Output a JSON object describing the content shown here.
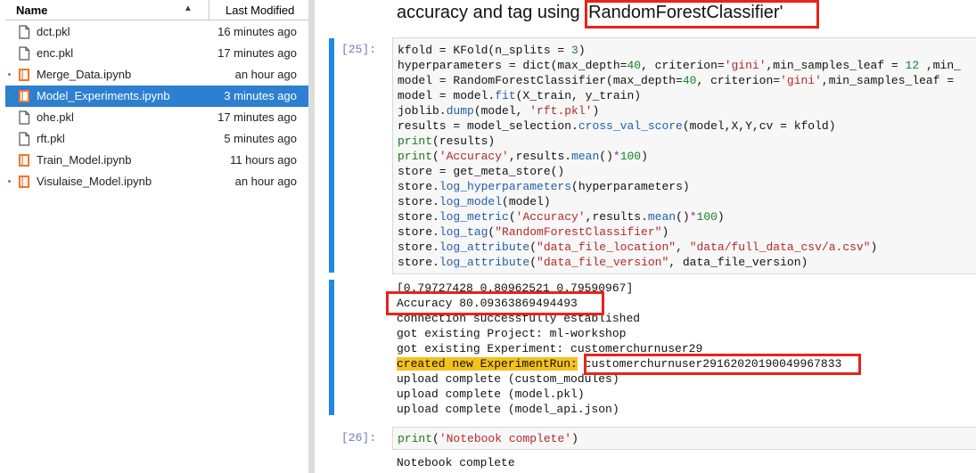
{
  "file_browser": {
    "header": {
      "name_label": "Name",
      "sort_indicator": "▲",
      "modified_label": "Last Modified"
    },
    "files": [
      {
        "name": "dct.pkl",
        "modified": "16 minutes ago",
        "type": "file",
        "running": false,
        "selected": false
      },
      {
        "name": "enc.pkl",
        "modified": "17 minutes ago",
        "type": "file",
        "running": false,
        "selected": false
      },
      {
        "name": "Merge_Data.ipynb",
        "modified": "an hour ago",
        "type": "notebook",
        "running": true,
        "selected": false
      },
      {
        "name": "Model_Experiments.ipynb",
        "modified": "3 minutes ago",
        "type": "notebook",
        "running": true,
        "selected": true
      },
      {
        "name": "ohe.pkl",
        "modified": "17 minutes ago",
        "type": "file",
        "running": false,
        "selected": false
      },
      {
        "name": "rft.pkl",
        "modified": "5 minutes ago",
        "type": "file",
        "running": false,
        "selected": false
      },
      {
        "name": "Train_Model.ipynb",
        "modified": "11 hours ago",
        "type": "notebook",
        "running": false,
        "selected": false
      },
      {
        "name": "Visulaise_Model.ipynb",
        "modified": "an hour ago",
        "type": "notebook",
        "running": true,
        "selected": false
      }
    ]
  },
  "notebook": {
    "markdown": {
      "text_before": "accuracy and tag using ",
      "highlight": "'RandomForestClassifier'"
    },
    "cell25": {
      "prompt": "[25]:",
      "code": {
        "l1": {
          "a": "kfold = KFold(n_splits = ",
          "b": "3",
          "c": ")"
        },
        "l2": {
          "a": "hyperparameters = dict(max_depth=",
          "b": "40",
          "c": ", criterion=",
          "d": "'gini'",
          "e": ",min_samples_leaf = ",
          "f": "12",
          "g": " ,min_"
        },
        "l3": {
          "a": "model = RandomForestClassifier(max_depth=",
          "b": "40",
          "c": ", criterion=",
          "d": "'gini'",
          "e": ",min_samples_leaf = "
        },
        "l4": {
          "a": "model = model.",
          "b": "fit",
          "c": "(X_train, y_train)"
        },
        "l5": {
          "a": "joblib.",
          "b": "dump",
          "c": "(model, ",
          "d": "'rft.pkl'",
          "e": ")"
        },
        "l6": {
          "a": "results = model_selection.",
          "b": "cross_val_score",
          "c": "(model,X,Y,cv = kfold)"
        },
        "l7": {
          "a": "print",
          "b": "(results)"
        },
        "l8": {
          "a": "print",
          "b": "(",
          "c": "'Accuracy'",
          "d": ",results.",
          "e": "mean",
          "f": "()",
          "g": "*",
          "h": "100",
          "i": ")"
        },
        "l9": {
          "a": "store = get_meta_store()"
        },
        "l10": {
          "a": "store.",
          "b": "log_hyperparameters",
          "c": "(hyperparameters)"
        },
        "l11": {
          "a": "store.",
          "b": "log_model",
          "c": "(model)"
        },
        "l12": {
          "a": "store.",
          "b": "log_metric",
          "c": "(",
          "d": "'Accuracy'",
          "e": ",results.",
          "f": "mean",
          "g": "()",
          "h": "*",
          "i": "100",
          "j": ")"
        },
        "l13": {
          "a": "store.",
          "b": "log_tag",
          "c": "(",
          "d": "\"RandomForestClassifier\"",
          "e": ")"
        },
        "l14": {
          "a": "store.",
          "b": "log_attribute",
          "c": "(",
          "d": "\"data_file_location\"",
          "e": ", ",
          "f": "\"data/full_data_csv/a.csv\"",
          "g": ")"
        },
        "l15": {
          "a": "store.",
          "b": "log_attribute",
          "c": "(",
          "d": "\"data_file_version\"",
          "e": ", data_file_version)"
        }
      },
      "output": {
        "results": "[0.79727428 0.80962521 0.79590967]",
        "accuracy": "Accuracy 80.09363869494493",
        "connection": "connection successfully established",
        "project": "got existing Project: ml-workshop",
        "experiment": "got existing Experiment: customerchurnuser29",
        "run_label": "created new ExperimentRun:",
        "run_id": "customerchurnuser29162020190049967833",
        "upload1": "upload complete (custom_modules)",
        "upload2": "upload complete (model.pkl)",
        "upload3": "upload complete (model_api.json)"
      }
    },
    "cell26": {
      "prompt": "[26]:",
      "code": {
        "a": "print",
        "b": "(",
        "c": "'Notebook complete'",
        "d": ")"
      },
      "output": "Notebook complete"
    }
  },
  "colors": {
    "selected_row": "#2d7fd0",
    "active_cell_bar": "#1e88e5",
    "highlight_box": "#e8231a",
    "stderr_highlight": "#f4c21a"
  }
}
